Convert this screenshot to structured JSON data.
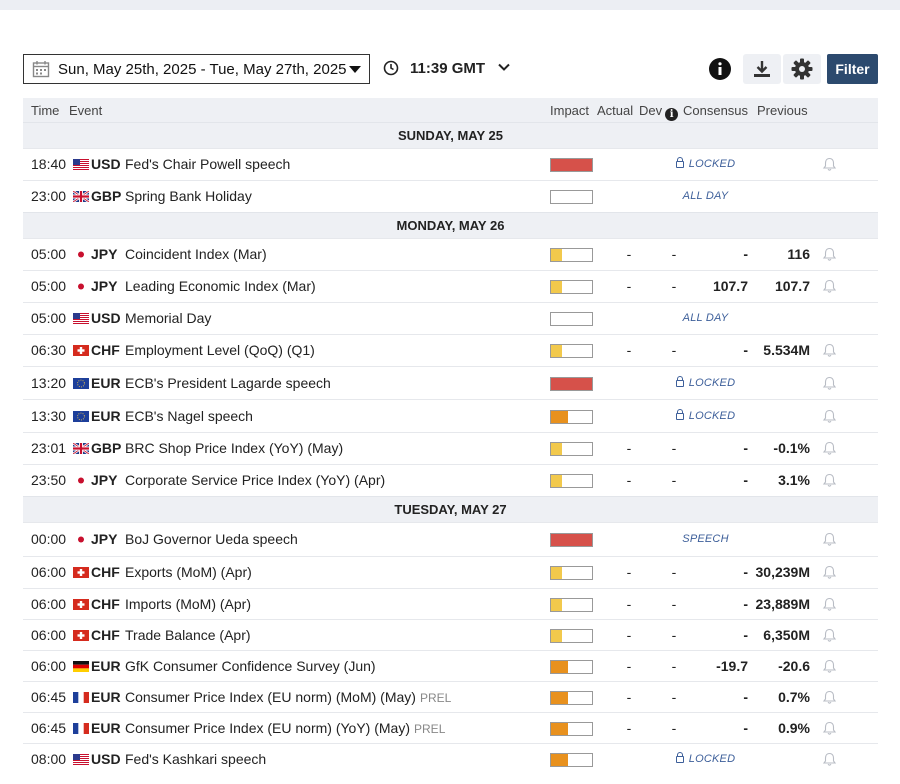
{
  "toolbar": {
    "date_range": "Sun, May 25th, 2025 -  Tue, May 27th, 2025",
    "time": "11:39 GMT",
    "filter_label": "Filter"
  },
  "columns": {
    "time": "Time",
    "event": "Event",
    "impact": "Impact",
    "actual": "Actual",
    "dev": "Dev",
    "consensus": "Consensus",
    "previous": "Previous"
  },
  "colors": {
    "high": "#d6514a",
    "medium": "#e8911e",
    "low": "#f2c94c",
    "accent": "#2c4a6e"
  },
  "days": [
    {
      "label": "SUNDAY, MAY 25",
      "events": [
        {
          "time": "18:40",
          "flag": "us",
          "currency": "USD",
          "event": "Fed's Chair Powell speech",
          "impact": "high",
          "badge": "LOCKED",
          "actual": "",
          "dev": "",
          "consensus": "",
          "previous": "",
          "bell": true
        },
        {
          "time": "23:00",
          "flag": "gb",
          "currency": "GBP",
          "event": "Spring Bank Holiday",
          "impact": "none",
          "badge": "ALL DAY",
          "actual": "",
          "dev": "",
          "consensus": "",
          "previous": "",
          "bell": false
        }
      ]
    },
    {
      "label": "MONDAY, MAY 26",
      "events": [
        {
          "time": "05:00",
          "flag": "jp",
          "currency": "JPY",
          "event": "Coincident Index (Mar)",
          "impact": "low",
          "actual": "-",
          "dev": "-",
          "consensus": "-",
          "previous": "116",
          "bell": true
        },
        {
          "time": "05:00",
          "flag": "jp",
          "currency": "JPY",
          "event": "Leading Economic Index (Mar)",
          "impact": "low",
          "actual": "-",
          "dev": "-",
          "consensus": "107.7",
          "previous": "107.7",
          "bell": true
        },
        {
          "time": "05:00",
          "flag": "us",
          "currency": "USD",
          "event": "Memorial Day",
          "impact": "none",
          "badge": "ALL DAY",
          "actual": "",
          "dev": "",
          "consensus": "",
          "previous": "",
          "bell": false
        },
        {
          "time": "06:30",
          "flag": "ch",
          "currency": "CHF",
          "event": "Employment Level (QoQ) (Q1)",
          "impact": "low",
          "actual": "-",
          "dev": "-",
          "consensus": "-",
          "previous": "5.534M",
          "bell": true
        },
        {
          "time": "13:20",
          "flag": "eu",
          "currency": "EUR",
          "event": "ECB's President Lagarde speech",
          "impact": "high",
          "badge": "LOCKED",
          "actual": "",
          "dev": "",
          "consensus": "",
          "previous": "",
          "bell": true
        },
        {
          "time": "13:30",
          "flag": "eu",
          "currency": "EUR",
          "event": "ECB's Nagel speech",
          "impact": "medium",
          "badge": "LOCKED",
          "actual": "",
          "dev": "",
          "consensus": "",
          "previous": "",
          "bell": true
        },
        {
          "time": "23:01",
          "flag": "gb",
          "currency": "GBP",
          "event": "BRC Shop Price Index (YoY) (May)",
          "impact": "low",
          "actual": "-",
          "dev": "-",
          "consensus": "-",
          "previous": "-0.1%",
          "bell": true
        },
        {
          "time": "23:50",
          "flag": "jp",
          "currency": "JPY",
          "event": "Corporate Service Price Index (YoY) (Apr)",
          "impact": "low",
          "actual": "-",
          "dev": "-",
          "consensus": "-",
          "previous": "3.1%",
          "bell": true
        }
      ]
    },
    {
      "label": "TUESDAY, MAY 27",
      "events": [
        {
          "time": "00:00",
          "flag": "jp",
          "currency": "JPY",
          "event": "BoJ Governor Ueda speech",
          "impact": "high",
          "badge": "SPEECH",
          "actual": "",
          "dev": "",
          "consensus": "",
          "previous": "",
          "bell": true
        },
        {
          "time": "06:00",
          "flag": "ch",
          "currency": "CHF",
          "event": "Exports (MoM) (Apr)",
          "impact": "low",
          "actual": "-",
          "dev": "-",
          "consensus": "-",
          "previous": "30,239M",
          "bell": true
        },
        {
          "time": "06:00",
          "flag": "ch",
          "currency": "CHF",
          "event": "Imports (MoM) (Apr)",
          "impact": "low",
          "actual": "-",
          "dev": "-",
          "consensus": "-",
          "previous": "23,889M",
          "bell": true
        },
        {
          "time": "06:00",
          "flag": "ch",
          "currency": "CHF",
          "event": "Trade Balance (Apr)",
          "impact": "low",
          "actual": "-",
          "dev": "-",
          "consensus": "-",
          "previous": "6,350M",
          "bell": true
        },
        {
          "time": "06:00",
          "flag": "de",
          "currency": "EUR",
          "event": "GfK Consumer Confidence Survey (Jun)",
          "impact": "medium",
          "actual": "-",
          "dev": "-",
          "consensus": "-19.7",
          "previous": "-20.6",
          "bell": true
        },
        {
          "time": "06:45",
          "flag": "fr",
          "currency": "EUR",
          "event": "Consumer Price Index (EU norm) (MoM) (May)",
          "prel": "PREL",
          "impact": "medium",
          "actual": "-",
          "dev": "-",
          "consensus": "-",
          "previous": "0.7%",
          "bell": true
        },
        {
          "time": "06:45",
          "flag": "fr",
          "currency": "EUR",
          "event": "Consumer Price Index (EU norm) (YoY) (May)",
          "prel": "PREL",
          "impact": "medium",
          "actual": "-",
          "dev": "-",
          "consensus": "-",
          "previous": "0.9%",
          "bell": true
        },
        {
          "time": "08:00",
          "flag": "us",
          "currency": "USD",
          "event": "Fed's Kashkari speech",
          "impact": "medium",
          "badge": "LOCKED",
          "actual": "",
          "dev": "",
          "consensus": "",
          "previous": "",
          "bell": true
        }
      ]
    }
  ]
}
